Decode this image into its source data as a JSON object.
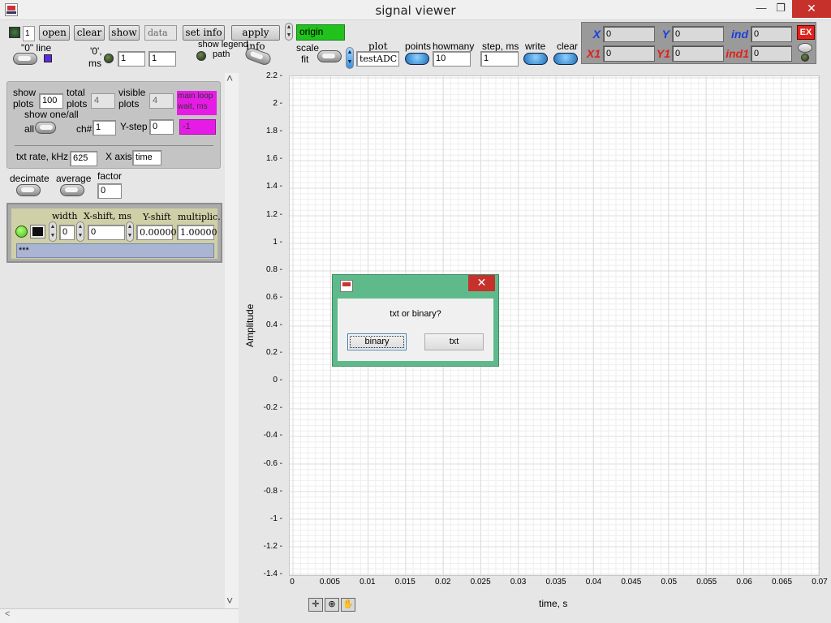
{
  "window": {
    "title": "signal viewer",
    "minimize": "—",
    "restore": "❐",
    "close": "✕"
  },
  "toolbar": {
    "line_counter": "1",
    "open": "open",
    "clear": "clear",
    "show": "show",
    "data_field": "data",
    "set_info": "set info",
    "apply_info": "apply info",
    "origin": "origin",
    "zero_line_label": "\"0\" line",
    "zero_ms_label_1": "'0',",
    "zero_ms_label_2": "ms",
    "zero_ms_a": "1",
    "zero_ms_b": "1",
    "show_legend": "show legend",
    "path": "path",
    "scale": "scale",
    "fit": "fit",
    "plot_label": "plot",
    "plot_value": "testADC",
    "points": "points",
    "howmany": "howmany",
    "howmany_value": "10",
    "step_ms": "step, ms",
    "step_value": "1",
    "write": "write",
    "clear2": "clear",
    "colors": {
      "origin": "#21c21c",
      "marker": "#5b2be0",
      "magenta": "#e61ce6"
    }
  },
  "coords": {
    "x_label": "X",
    "y_label": "Y",
    "ind_label": "ind",
    "x1_label": "X1",
    "y1_label": "Y1",
    "ind1_label": "ind1",
    "x": "0",
    "y": "0",
    "ind": "0",
    "x1": "0",
    "y1": "0",
    "ind1": "0",
    "ex": "EX"
  },
  "left_panel": {
    "show_plots_1": "show",
    "show_plots_2": "plots",
    "show_plots_value": "100",
    "total_plots_1": "total",
    "total_plots_2": "plots",
    "total_plots_value": "4",
    "visible_plots_1": "visible",
    "visible_plots_2": "plots",
    "visible_plots_value": "4",
    "main_loop_1": "main loop",
    "main_loop_2": "wait, ms",
    "main_loop_value": "-1",
    "show_one_all": "show one/all",
    "all": "all",
    "ch_label": "ch#",
    "ch_value": "1",
    "y_step": "Y-step",
    "y_step_value": "0",
    "txt_rate": "txt rate, kHz",
    "txt_rate_value": "625",
    "x_axis": "X axis",
    "x_axis_value": "time",
    "decimate": "decimate",
    "average": "average",
    "factor": "factor",
    "factor_value": "0",
    "width": "width",
    "width_value": "0",
    "x_shift": "X-shift, ms",
    "x_shift_value": "0",
    "y_shift": "Y-shift",
    "y_shift_value": "0.00000",
    "multiplic": "multiplic.",
    "multiplic_value": "1.00000",
    "comment": "***",
    "scroll_up": "˄",
    "scroll_down": "˅",
    "scroll_left": "<"
  },
  "graph": {
    "y_title": "Amplitude",
    "x_title": "time, s",
    "y_ticks": [
      "2.2",
      "2",
      "1.8",
      "1.6",
      "1.4",
      "1.2",
      "1",
      "0.8",
      "0.6",
      "0.4",
      "0.2",
      "0",
      "-0.2",
      "-0.4",
      "-0.6",
      "-0.8",
      "-1",
      "-1.2",
      "-1.4"
    ],
    "x_ticks": [
      "0",
      "0.005",
      "0.01",
      "0.015",
      "0.02",
      "0.025",
      "0.03",
      "0.035",
      "0.04",
      "0.045",
      "0.05",
      "0.055",
      "0.06",
      "0.065",
      "0.07"
    ],
    "tools": {
      "cursor": "✛",
      "zoom": "⊕",
      "pan": "✋"
    }
  },
  "dialog": {
    "message": "txt or binary?",
    "binary": "binary",
    "txt": "txt",
    "close": "✕"
  }
}
